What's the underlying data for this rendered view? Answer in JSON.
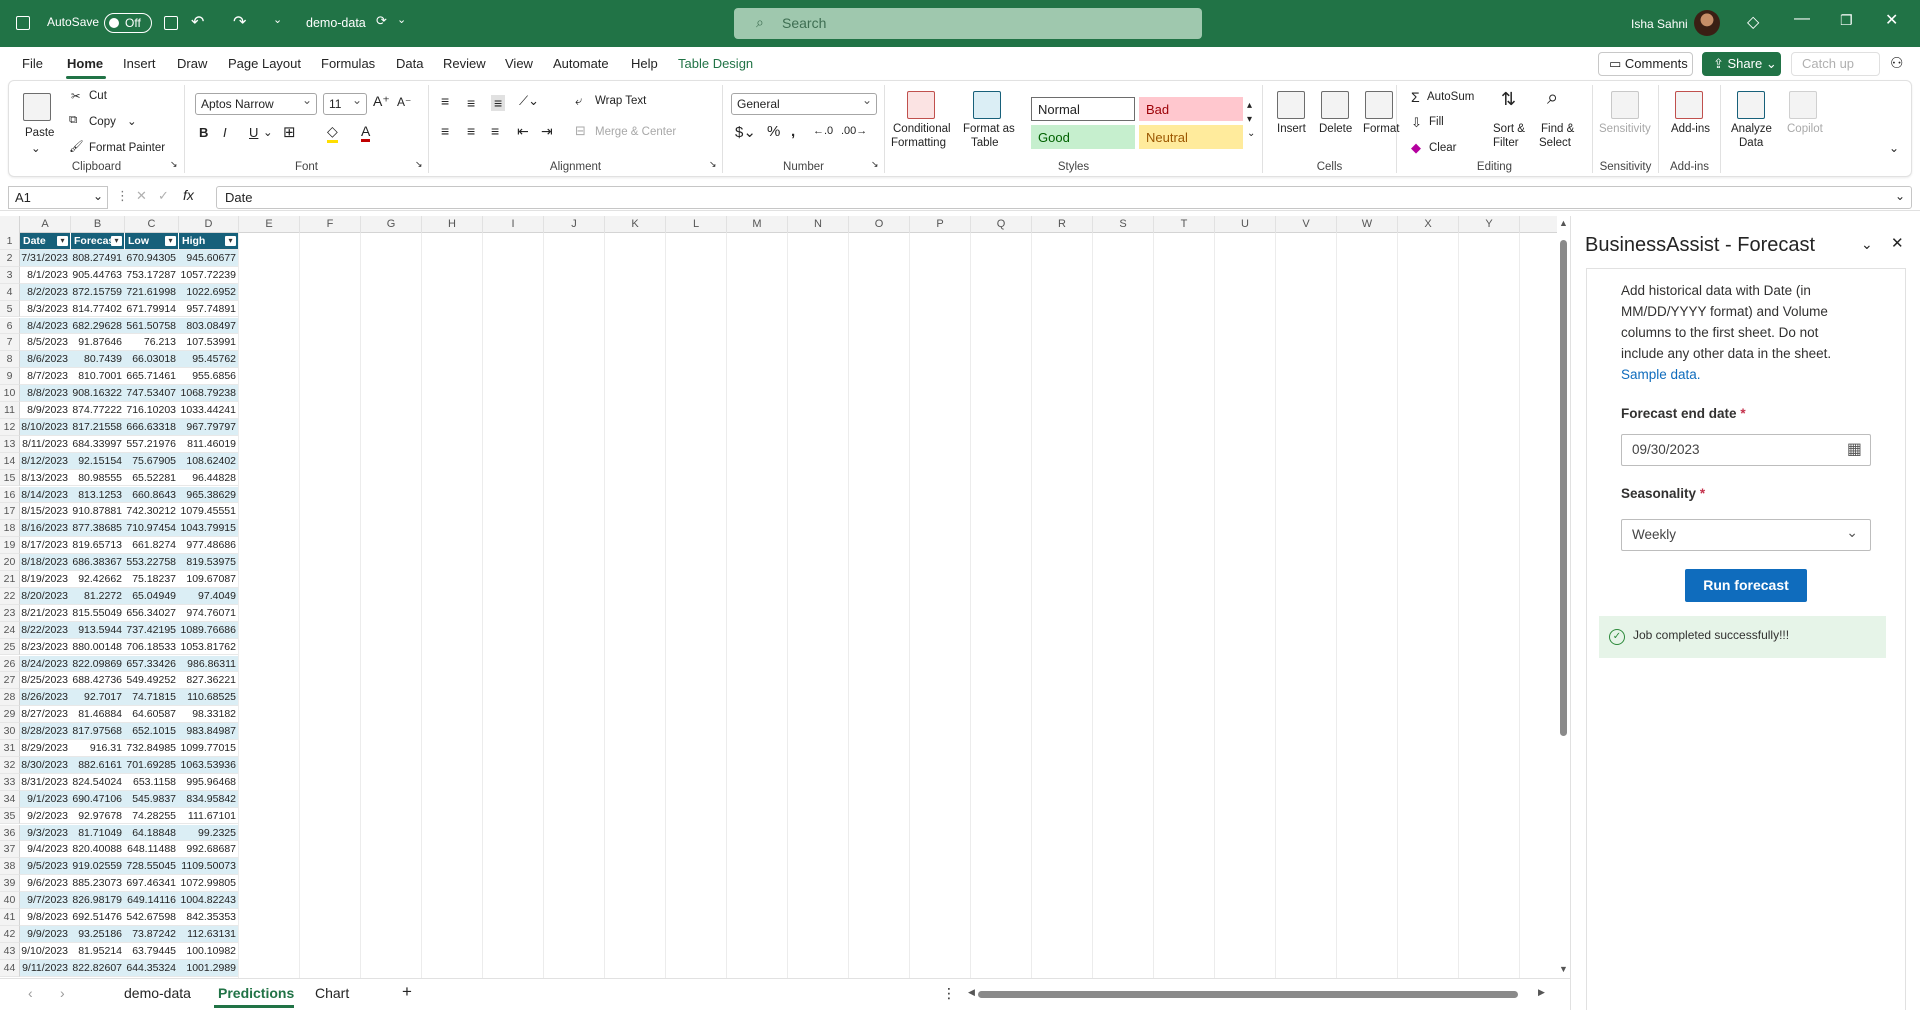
{
  "titlebar": {
    "autosave_label": "AutoSave",
    "autosave_state": "Off",
    "file_name": "demo-data",
    "search_placeholder": "Search",
    "user_name": "Isha Sahni",
    "accent_color": "#217346"
  },
  "menu": {
    "items": [
      "File",
      "Home",
      "Insert",
      "Draw",
      "Page Layout",
      "Formulas",
      "Data",
      "Review",
      "View",
      "Automate",
      "Help",
      "Table Design"
    ],
    "active": "Home",
    "comments_label": "Comments",
    "share_label": "Share",
    "catchup_label": "Catch up"
  },
  "ribbon": {
    "clipboard": {
      "label": "Clipboard",
      "paste": "Paste",
      "cut": "Cut",
      "copy": "Copy",
      "format_painter": "Format Painter"
    },
    "font": {
      "label": "Font",
      "name": "Aptos Narrow",
      "size": "11",
      "bold": "B",
      "italic": "I",
      "underline": "U"
    },
    "alignment": {
      "label": "Alignment",
      "wrap_text": "Wrap Text",
      "merge_center": "Merge & Center"
    },
    "number": {
      "label": "Number",
      "format": "General"
    },
    "styles": {
      "label": "Styles",
      "conditional": [
        "Conditional",
        "Formatting"
      ],
      "format_table": [
        "Format as",
        "Table"
      ],
      "normal": "Normal",
      "bad": "Bad",
      "good": "Good",
      "neutral": "Neutral"
    },
    "cells": {
      "label": "Cells",
      "insert": "Insert",
      "delete": "Delete",
      "format": "Format"
    },
    "editing": {
      "label": "Editing",
      "autosum": "AutoSum",
      "fill": "Fill",
      "clear": "Clear",
      "sort": [
        "Sort &",
        "Filter"
      ],
      "find": [
        "Find &",
        "Select"
      ]
    },
    "sensitivity": {
      "label": "Sensitivity",
      "button": "Sensitivity"
    },
    "addins": {
      "label": "Add-ins",
      "button": "Add-ins"
    },
    "analyze": [
      "Analyze",
      "Data"
    ],
    "copilot": "Copilot"
  },
  "formula_bar": {
    "name_box": "A1",
    "fx": "fx",
    "content": "Date"
  },
  "grid": {
    "columns": [
      "A",
      "B",
      "C",
      "D",
      "E",
      "F",
      "G",
      "H",
      "I",
      "J",
      "K",
      "L",
      "M",
      "N",
      "O",
      "P",
      "Q",
      "R",
      "S",
      "T",
      "U",
      "V",
      "W",
      "X",
      "Y"
    ],
    "headers": [
      "Date",
      "Forecast",
      "Low",
      "High"
    ],
    "rows": [
      [
        "7/31/2023",
        "808.27491",
        "670.94305",
        "945.60677"
      ],
      [
        "8/1/2023",
        "905.44763",
        "753.17287",
        "1057.72239"
      ],
      [
        "8/2/2023",
        "872.15759",
        "721.61998",
        "1022.6952"
      ],
      [
        "8/3/2023",
        "814.77402",
        "671.79914",
        "957.74891"
      ],
      [
        "8/4/2023",
        "682.29628",
        "561.50758",
        "803.08497"
      ],
      [
        "8/5/2023",
        "91.87646",
        "76.213",
        "107.53991"
      ],
      [
        "8/6/2023",
        "80.7439",
        "66.03018",
        "95.45762"
      ],
      [
        "8/7/2023",
        "810.7001",
        "665.71461",
        "955.6856"
      ],
      [
        "8/8/2023",
        "908.16322",
        "747.53407",
        "1068.79238"
      ],
      [
        "8/9/2023",
        "874.77222",
        "716.10203",
        "1033.44241"
      ],
      [
        "8/10/2023",
        "817.21558",
        "666.63318",
        "967.79797"
      ],
      [
        "8/11/2023",
        "684.33997",
        "557.21976",
        "811.46019"
      ],
      [
        "8/12/2023",
        "92.15154",
        "75.67905",
        "108.62402"
      ],
      [
        "8/13/2023",
        "80.98555",
        "65.52281",
        "96.44828"
      ],
      [
        "8/14/2023",
        "813.1253",
        "660.8643",
        "965.38629"
      ],
      [
        "8/15/2023",
        "910.87881",
        "742.30212",
        "1079.45551"
      ],
      [
        "8/16/2023",
        "877.38685",
        "710.97454",
        "1043.79915"
      ],
      [
        "8/17/2023",
        "819.65713",
        "661.8274",
        "977.48686"
      ],
      [
        "8/18/2023",
        "686.38367",
        "553.22758",
        "819.53975"
      ],
      [
        "8/19/2023",
        "92.42662",
        "75.18237",
        "109.67087"
      ],
      [
        "8/20/2023",
        "81.2272",
        "65.04949",
        "97.4049"
      ],
      [
        "8/21/2023",
        "815.55049",
        "656.34027",
        "974.76071"
      ],
      [
        "8/22/2023",
        "913.5944",
        "737.42195",
        "1089.76686"
      ],
      [
        "8/23/2023",
        "880.00148",
        "706.18533",
        "1053.81762"
      ],
      [
        "8/24/2023",
        "822.09869",
        "657.33426",
        "986.86311"
      ],
      [
        "8/25/2023",
        "688.42736",
        "549.49252",
        "827.36221"
      ],
      [
        "8/26/2023",
        "92.7017",
        "74.71815",
        "110.68525"
      ],
      [
        "8/27/2023",
        "81.46884",
        "64.60587",
        "98.33182"
      ],
      [
        "8/28/2023",
        "817.97568",
        "652.1015",
        "983.84987"
      ],
      [
        "8/29/2023",
        "916.31",
        "732.84985",
        "1099.77015"
      ],
      [
        "8/30/2023",
        "882.6161",
        "701.69285",
        "1063.53936"
      ],
      [
        "8/31/2023",
        "824.54024",
        "653.1158",
        "995.96468"
      ],
      [
        "9/1/2023",
        "690.47106",
        "545.9837",
        "834.95842"
      ],
      [
        "9/2/2023",
        "92.97678",
        "74.28255",
        "111.67101"
      ],
      [
        "9/3/2023",
        "81.71049",
        "64.18848",
        "99.2325"
      ],
      [
        "9/4/2023",
        "820.40088",
        "648.11488",
        "992.68687"
      ],
      [
        "9/5/2023",
        "919.02559",
        "728.55045",
        "1109.50073"
      ],
      [
        "9/6/2023",
        "885.23073",
        "697.46341",
        "1072.99805"
      ],
      [
        "9/7/2023",
        "826.98179",
        "649.14116",
        "1004.82243"
      ],
      [
        "9/8/2023",
        "692.51476",
        "542.67598",
        "842.35353"
      ],
      [
        "9/9/2023",
        "93.25186",
        "73.87242",
        "112.63131"
      ],
      [
        "9/10/2023",
        "81.95214",
        "63.79445",
        "100.10982"
      ],
      [
        "9/11/2023",
        "822.82607",
        "644.35324",
        "1001.2989"
      ]
    ]
  },
  "sheets": {
    "tabs": [
      "demo-data",
      "Predictions",
      "Chart"
    ],
    "active": "Predictions"
  },
  "pane": {
    "title": "BusinessAssist - Forecast",
    "desc_lines": [
      "Add historical data with Date (in",
      "MM/DD/YYYY format) and Volume",
      "columns to the first sheet. Do not",
      "include any other data in the sheet."
    ],
    "sample_link": "Sample data.",
    "end_date_label": "Forecast end date",
    "end_date_value": "09/30/2023",
    "seasonality_label": "Seasonality",
    "seasonality_value": "Weekly",
    "required_mark": "*",
    "run_label": "Run forecast",
    "status": "Job completed successfully!!!"
  }
}
